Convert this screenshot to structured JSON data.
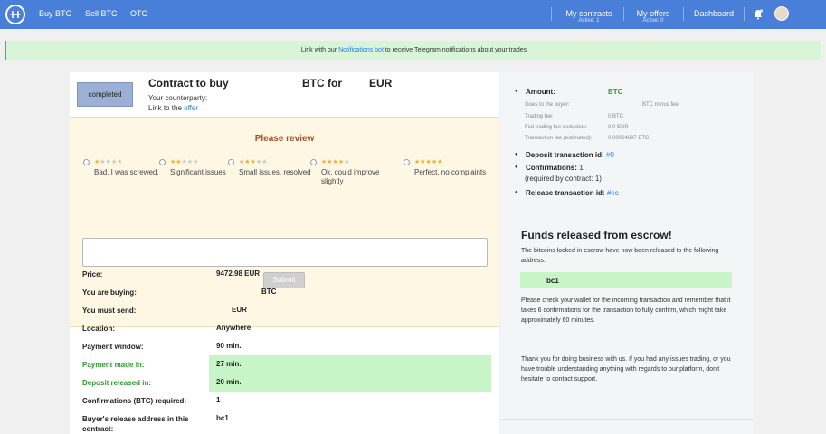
{
  "nav": {
    "links": [
      "Buy BTC",
      "Sell BTC",
      "OTC"
    ],
    "my_contracts": {
      "label": "My contracts",
      "sub": "Active: 1"
    },
    "my_offers": {
      "label": "My offers",
      "sub": "Active: 0"
    },
    "dashboard": "Dashboard"
  },
  "banner": {
    "before": "Link with our ",
    "link": "Notifications bot",
    "after": " to receive Telegram notifications about your trades"
  },
  "contract": {
    "status": "completed",
    "title_left": "Contract to buy",
    "title_mid": "BTC for",
    "title_right": "EUR",
    "counterparty": "Your counterparty:",
    "link_to": "Link to the ",
    "offer_link": "offer"
  },
  "review": {
    "title": "Please review",
    "options": [
      {
        "stars_on": 1,
        "label": "Bad, I was screwed."
      },
      {
        "stars_on": 2,
        "label": "Significant issues"
      },
      {
        "stars_on": 3,
        "label": "Small issues, resolved"
      },
      {
        "stars_on": 4,
        "label": "Ok, could improve slightly"
      },
      {
        "stars_on": 5,
        "label": "Perfect, no complaints"
      }
    ],
    "submit": "Submit"
  },
  "details": [
    {
      "key": "Price:",
      "value": "9472.98 EUR",
      "highlight": false
    },
    {
      "key": "You are buying:",
      "value": "BTC",
      "highlight": false,
      "indent": true
    },
    {
      "key": "You must send:",
      "value": "EUR",
      "highlight": false,
      "indent": true
    },
    {
      "key": "Location:",
      "value": "Anywhere",
      "highlight": false
    },
    {
      "key": "Payment window:",
      "value": "90 min.",
      "highlight": false
    },
    {
      "key": "Payment made in:",
      "value": "27  min.",
      "highlight": true
    },
    {
      "key": "Deposit released in:",
      "value": "20  min.",
      "highlight": true
    },
    {
      "key": "Confirmations (BTC) required:",
      "value": "1",
      "highlight": false
    },
    {
      "key": "Buyer's release address in this contract:",
      "value": "bc1",
      "highlight": false
    }
  ],
  "right": {
    "amount_label": "Amount:",
    "amount_value": "BTC",
    "fees": [
      {
        "k": "Goes to the buyer:",
        "v": "BTC minus fee"
      },
      {
        "k": "Trading fee:",
        "v": "0 BTC"
      },
      {
        "k": "Fiat trading fee deduction:",
        "v": "0.0 EUR"
      },
      {
        "k": "Transaction fee (estimated):",
        "v": "0.00024897 BTC"
      }
    ],
    "deposit_tx_label": "Deposit transaction id: ",
    "deposit_tx_value": "#0",
    "confirmations_label": "Confirmations: ",
    "confirmations_value": "1",
    "confirmations_note": "(required by contract: 1)",
    "release_tx_label": "Release transaction id: ",
    "release_tx_value": "#ec",
    "funds_title": "Funds released from escrow!",
    "funds_text": "The bitcoins locked in escrow have now been released to the following address:",
    "address": "bc1",
    "check_text": "Please check your wallet for the incoming transaction and remember that it takes 6 confirmations for the transaction to fully confirm, which might take approximately 60 minutes.",
    "thanks_text": "Thank you for doing business with us. If you had any issues trading, or you have trouble understanding anything with regards to our platform, don't hesitate to contact support."
  },
  "colors": {
    "nav": "#4a7fd9",
    "highlight": "#c8f5c8",
    "review_bg": "#fdf7e3",
    "accent_green": "#2e9a2e",
    "link": "#2a7de1"
  }
}
